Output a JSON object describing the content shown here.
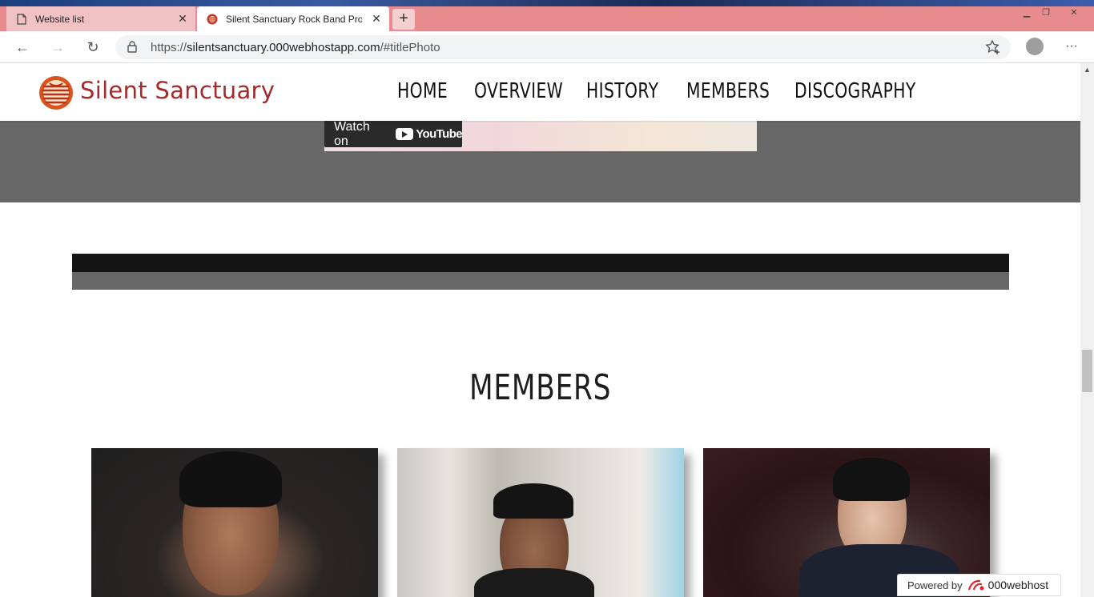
{
  "browser": {
    "tabs": [
      {
        "title": "Website list",
        "icon": "page-icon",
        "active": false
      },
      {
        "title": "Silent Sanctuary Rock Band Profi",
        "icon": "site-favicon",
        "active": true
      }
    ],
    "new_tab_label": "+",
    "url_scheme": "https://",
    "url_host": "silentsanctuary.000webhostapp.com",
    "url_path": "/#titlePhoto"
  },
  "site": {
    "brand": "Silent Sanctuary",
    "nav": [
      "HOME",
      "OVERVIEW",
      "HISTORY",
      "MEMBERS",
      "DISCOGRAPHY"
    ],
    "video": {
      "watch_on": "Watch on",
      "youtube": "YouTube"
    },
    "members_title": "MEMBERS",
    "members": [
      {
        "photo": "member-photo-1"
      },
      {
        "photo": "member-photo-2"
      },
      {
        "photo": "member-photo-3"
      }
    ]
  },
  "footer_badge": {
    "powered_by": "Powered by",
    "host": "000webhost"
  },
  "colors": {
    "brand_red": "#a52a2a",
    "tabbar": "#e88b8f",
    "band_grey": "#676767",
    "band_dark": "#141414"
  }
}
